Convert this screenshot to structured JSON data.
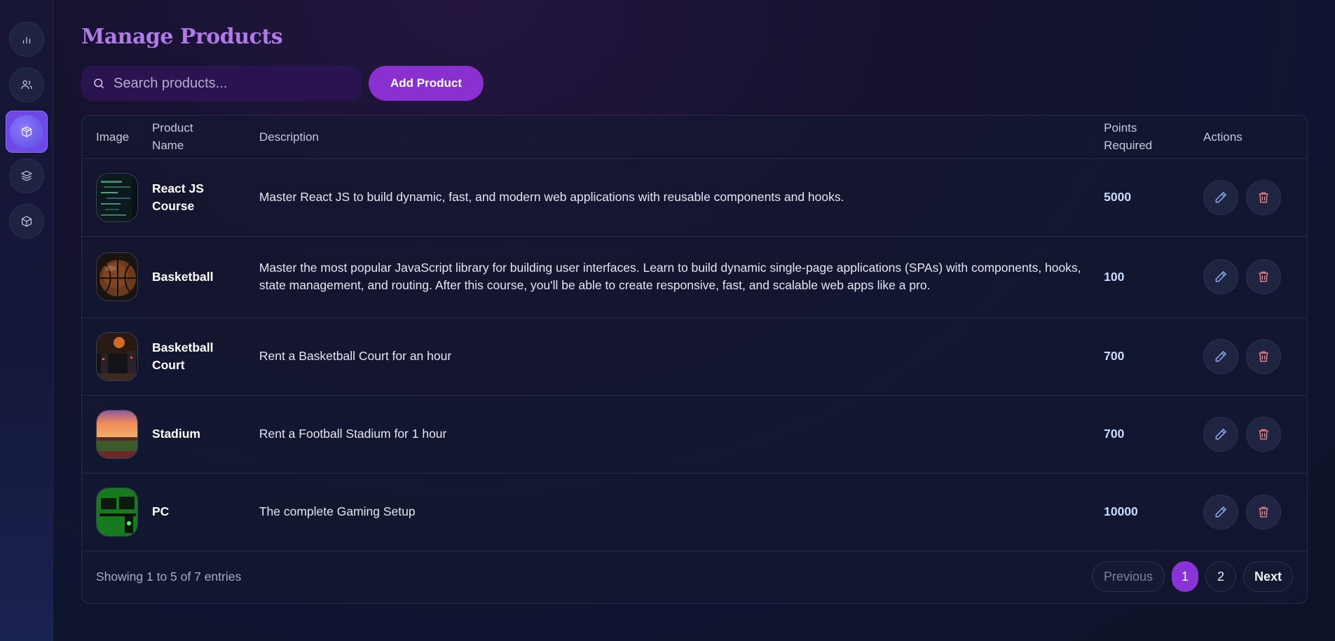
{
  "page": {
    "title": "Manage Products"
  },
  "sidebar": {
    "items": [
      {
        "icon": "bar-chart-icon",
        "active": false
      },
      {
        "icon": "users-icon",
        "active": false
      },
      {
        "icon": "box-icon",
        "active": true
      },
      {
        "icon": "layers-icon",
        "active": false
      },
      {
        "icon": "box-icon",
        "active": false
      }
    ]
  },
  "toolbar": {
    "search_placeholder": "Search products...",
    "add_label": "Add Product"
  },
  "table": {
    "headers": {
      "image": "Image",
      "name": "Product Name",
      "description": "Description",
      "points": "Points Required",
      "actions": "Actions"
    },
    "rows": [
      {
        "name": "React JS Course",
        "description": "Master React JS to build dynamic, fast, and modern web applications with reusable components and hooks.",
        "points": "5000"
      },
      {
        "name": "Basketball",
        "description": "Master the most popular JavaScript library for building user interfaces. Learn to build dynamic single-page applications (SPAs) with components, hooks, state management, and routing. After this course, you'll be able to create responsive, fast, and scalable web apps like a pro.",
        "points": "100"
      },
      {
        "name": "Basketball Court",
        "description": "Rent a Basketball Court for an hour",
        "points": "700"
      },
      {
        "name": "Stadium",
        "description": "Rent a Football Stadium for 1 hour",
        "points": "700"
      },
      {
        "name": "PC",
        "description": "The complete Gaming Setup",
        "points": "10000"
      }
    ]
  },
  "footer": {
    "showing": "Showing 1 to 5 of 7 entries",
    "previous": "Previous",
    "page1": "1",
    "page2": "2",
    "next": "Next",
    "current_page": 1
  },
  "colors": {
    "accent": "#8a2fd0",
    "title": "#b07ae8",
    "points": "#c8dcff",
    "edit_icon": "#8fb4ff",
    "delete_icon": "#f27e88"
  }
}
